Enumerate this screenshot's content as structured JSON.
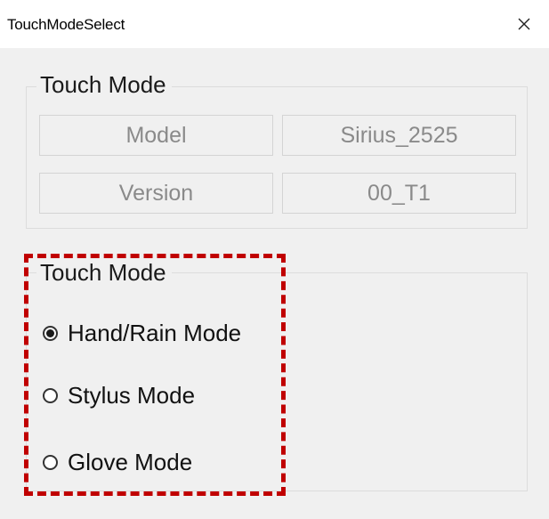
{
  "window": {
    "title": "TouchModeSelect",
    "close_glyph": "close-icon"
  },
  "info_group": {
    "legend": "Touch Mode",
    "model_label": "Model",
    "model_value": "Sirius_2525",
    "version_label": "Version",
    "version_value": "00_T1"
  },
  "mode_group": {
    "legend": "Touch Mode",
    "options": [
      {
        "label": "Hand/Rain Mode",
        "checked": true
      },
      {
        "label": "Stylus Mode",
        "checked": false
      },
      {
        "label": "Glove Mode",
        "checked": false
      }
    ]
  },
  "colors": {
    "annotation": "#c00000",
    "window_bg": "#f0f0f0",
    "disabled_text": "#8a8a8a"
  }
}
